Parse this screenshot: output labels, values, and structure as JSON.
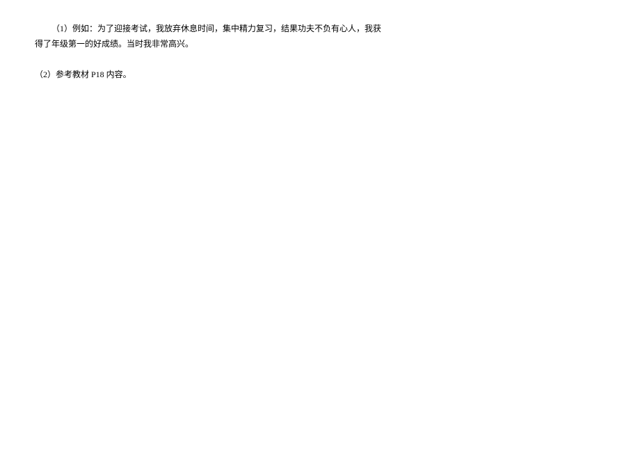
{
  "answers": {
    "item1": {
      "line1": "（1）例如：为了迎接考试，我放弃休息时间，集中精力复习，结果功夫不负有心人，我获",
      "line2": "得了年级第一的好成绩。当时我非常高兴。"
    },
    "item2": {
      "text": "（2）参考教材 P18 内容。"
    }
  }
}
